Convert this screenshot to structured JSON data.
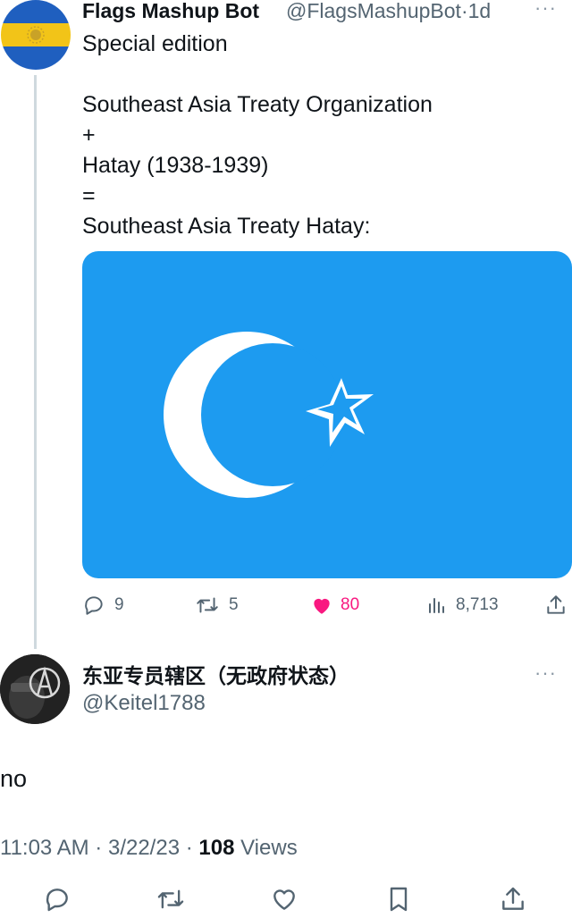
{
  "original_tweet": {
    "author_name": "Flags Mashup Bot",
    "author_handle": "@FlagsMashupBot",
    "separator": "·",
    "time_ago": "1d",
    "text": "Special edition\n\nSoutheast Asia Treaty Organization\n+\nHatay (1938-1939)\n=\nSoutheast Asia Treaty Hatay:",
    "more_icon": "more-horizontal-icon",
    "stats": {
      "replies": "9",
      "retweets": "5",
      "likes": "80",
      "views": "8,713"
    },
    "like_color": "#f91880",
    "flag_colors": {
      "field": "#1d9bf0",
      "emblem": "#ffffff"
    }
  },
  "reply_tweet": {
    "author_name": "东亚专员辖区（无政府状态）",
    "author_handle": "@Keitel1788",
    "text": "no",
    "time": "11:03 AM",
    "separator": "·",
    "date": "3/22/23",
    "views_count": "108",
    "views_label": "Views"
  },
  "icons": [
    "reply-icon",
    "retweet-icon",
    "like-icon",
    "views-icon",
    "share-icon",
    "bookmark-icon"
  ]
}
